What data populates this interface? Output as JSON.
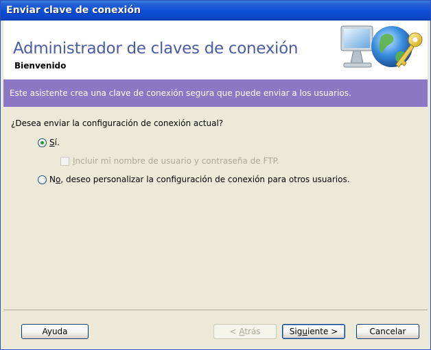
{
  "window": {
    "title": "Enviar clave de conexión"
  },
  "header": {
    "title": "Administrador de claves de conexión",
    "subtitle": "Bienvenido",
    "art_icon": "computer-globe-key-icon"
  },
  "banner": {
    "text": "Este asistente crea una clave de conexión segura que puede enviar a los usuarios."
  },
  "content": {
    "question": "¿Desea enviar la configuración de conexión actual?",
    "option_yes": {
      "label_mnemonic": "S",
      "label_rest": "í.",
      "checked": true
    },
    "include_credentials": {
      "label_mnemonic": "I",
      "label_rest": "ncluir mi nombre de usuario y contraseña de FTP.",
      "checked": false,
      "enabled": false
    },
    "option_no": {
      "label_pre": "N",
      "label_mnemonic": "o",
      "label_rest": ", deseo personalizar la configuración de conexión para otros usuarios.",
      "checked": false
    }
  },
  "buttons": {
    "help": "Ayuda",
    "back_pre": "< ",
    "back_mnemonic": "A",
    "back_rest": "trás",
    "next_pre": "Sig",
    "next_mnemonic": "u",
    "next_rest": "iente >",
    "cancel": "Cancelar"
  },
  "colors": {
    "title_bar": "#0b47c9",
    "header_title": "#4b5ba6",
    "banner": "#8a78c4",
    "dialog_bg": "#ece9d8"
  }
}
